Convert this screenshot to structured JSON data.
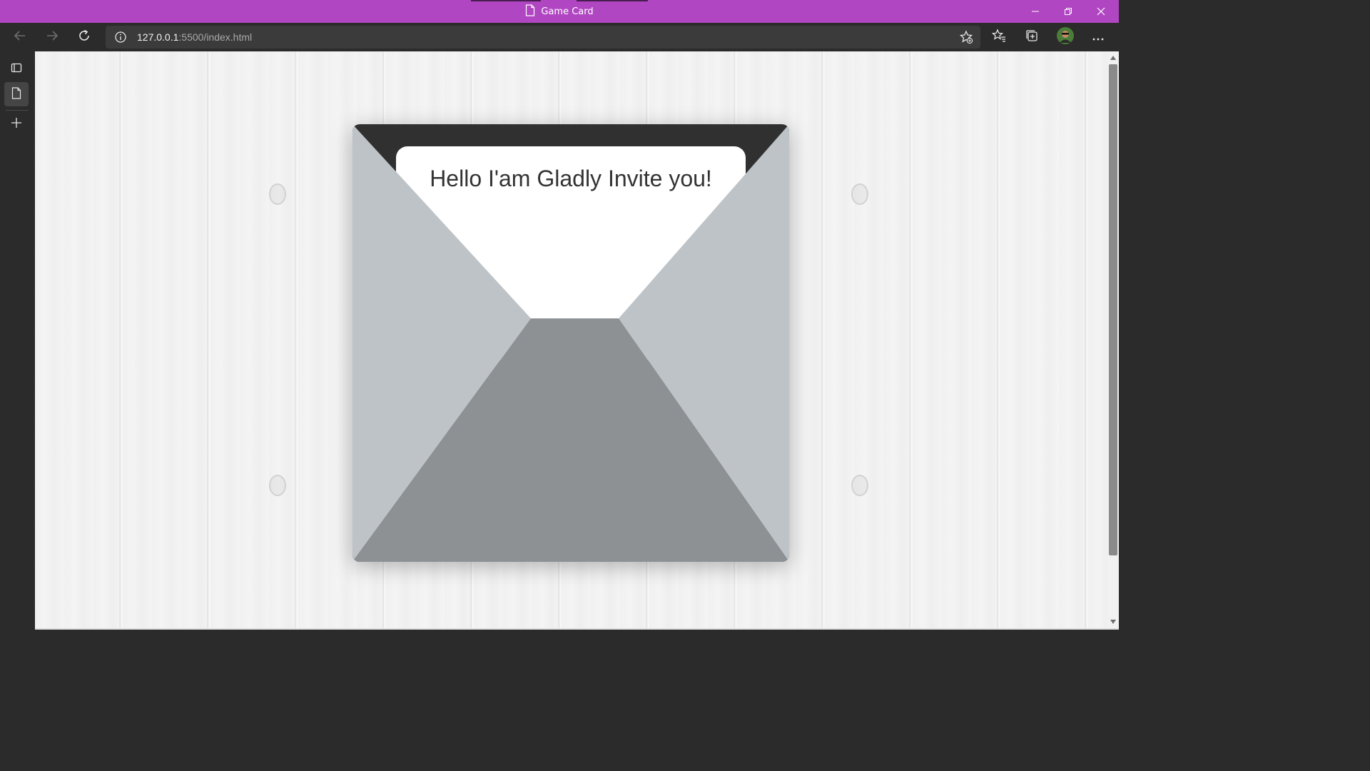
{
  "window": {
    "title": "Game Card",
    "accent_color": "#b146c2"
  },
  "toolbar": {
    "url_host": "127.0.0.1",
    "url_rest": ":5500/index.html"
  },
  "icons": {
    "back": "back-arrow-icon",
    "forward": "forward-arrow-icon",
    "refresh": "refresh-icon",
    "site_info": "info-icon",
    "add_favorite": "star-plus-icon",
    "favorites": "favorites-icon",
    "collections": "collections-icon",
    "profile": "avatar",
    "more": "more-icon",
    "tab_actions": "tab-actions-icon",
    "page_tab": "page-icon",
    "new_tab": "plus-icon"
  },
  "card": {
    "message": "Hello I'am Gladly Invite you!",
    "colors": {
      "flap_top": "#303030",
      "letter": "#ffffff",
      "sides": "#bdc3c7",
      "bottom": "#8d9194"
    }
  }
}
